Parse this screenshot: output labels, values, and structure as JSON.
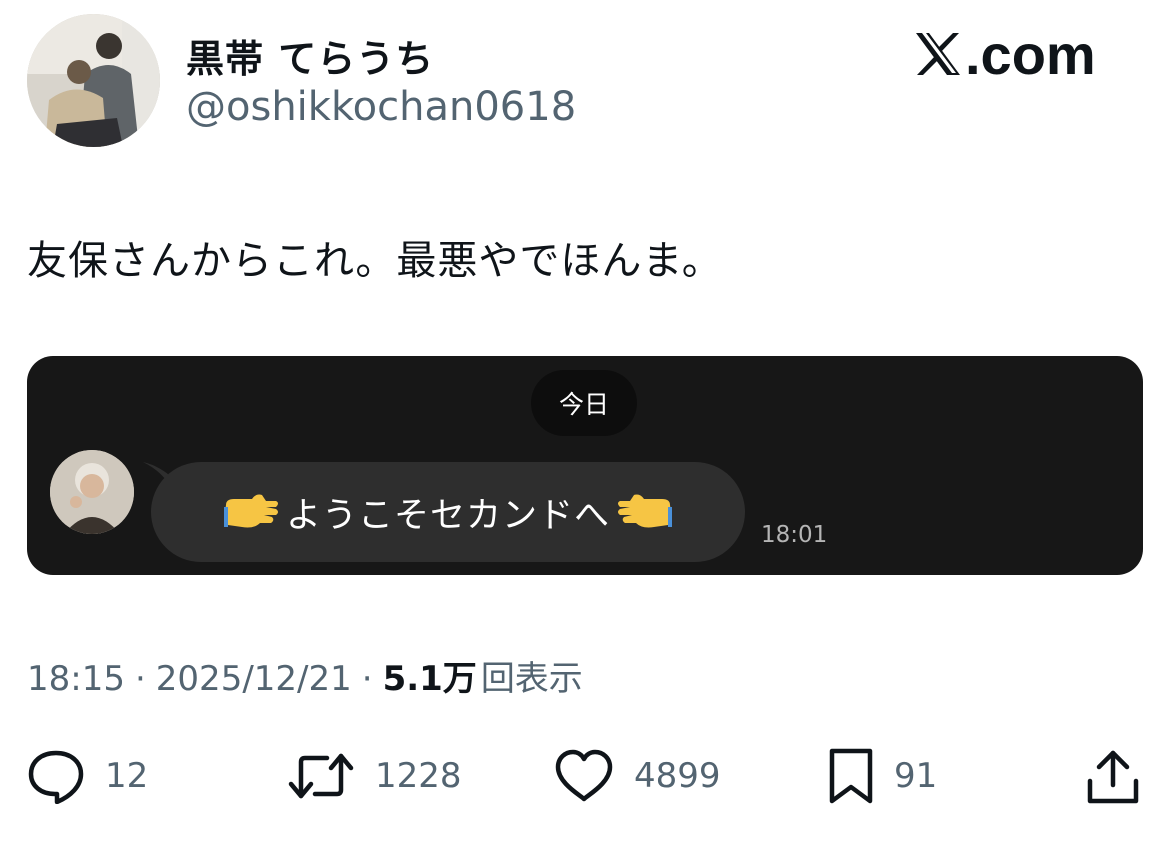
{
  "header": {
    "display_name": "黒帯 てらうち",
    "handle": "@oshikkochan0618",
    "brand_label": ".com",
    "avatar_icon": "profile-photo"
  },
  "tweet": {
    "text": "友保さんからこれ。最悪やでほんま。"
  },
  "media": {
    "day_label": "今日",
    "sender_avatar_icon": "elderly-woman-photo",
    "message_emoji_left": "🫱",
    "message_text": "ようこそセカンドへ",
    "message_emoji_right": "🫲",
    "message_time": "18:01",
    "background_color": "#171717",
    "bubble_color": "#2e2e2e"
  },
  "meta": {
    "time": "18:15",
    "separator": "·",
    "date": "2025/12/21",
    "views_count": "5.1万",
    "views_label": "回表示"
  },
  "actions": {
    "replies": "12",
    "reposts": "1228",
    "likes": "4899",
    "bookmarks": "91"
  },
  "colors": {
    "text_primary": "#0f1419",
    "text_secondary": "#536471"
  }
}
